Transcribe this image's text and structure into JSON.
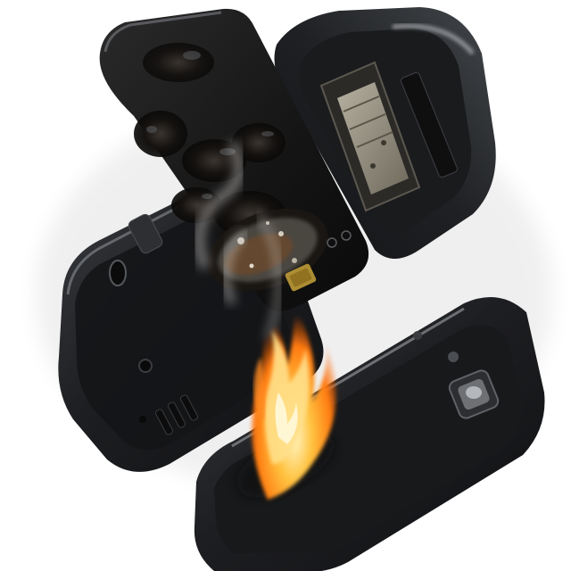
{
  "scene": {
    "subject": "burnt-mobile-phone",
    "background_color": "#ffffff",
    "colors": {
      "plastic_dark": "#1b1c1e",
      "plastic_mid": "#2c2e31",
      "plastic_highlight": "#8a8d91",
      "char_black": "#0c0b0a",
      "ash_grey": "#6b6760",
      "rust": "#7a4a22",
      "flame_core": "#fff2b0",
      "flame_mid": "#ffb12e",
      "flame_outer": "#ff6a00",
      "smoke": "#d8d6d2",
      "metal": "#a9a395"
    },
    "icons": [
      "flame-icon",
      "smoke-icon",
      "battery-icon",
      "sim-slot-icon",
      "speaker-grille-icon",
      "camera-lens-icon"
    ]
  }
}
